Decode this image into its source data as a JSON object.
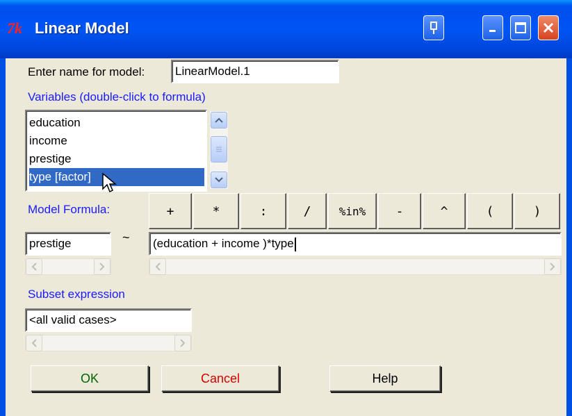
{
  "window": {
    "title": "Linear Model",
    "app_icon_text": "7k"
  },
  "model_name": {
    "label": "Enter name for model:",
    "value": "LinearModel.1"
  },
  "variables": {
    "label": "Variables (double-click to formula)",
    "items": [
      "education",
      "income",
      "prestige",
      "type [factor]"
    ],
    "selected_index": 3
  },
  "formula": {
    "label": "Model Formula:",
    "operators": [
      "+",
      "*",
      ":",
      "/",
      "%in%",
      "-",
      "^",
      "(",
      ")"
    ],
    "lhs": "prestige",
    "tilde": "~",
    "rhs": "(education  + income )*type"
  },
  "subset": {
    "label": "Subset expression",
    "value": "<all valid cases>"
  },
  "buttons": {
    "ok": "OK",
    "cancel": "Cancel",
    "help": "Help"
  },
  "colors": {
    "label_blue": "#1a1aff",
    "cancel_red": "#d40000",
    "ok_green": "#006400",
    "selection": "#316ac5"
  }
}
